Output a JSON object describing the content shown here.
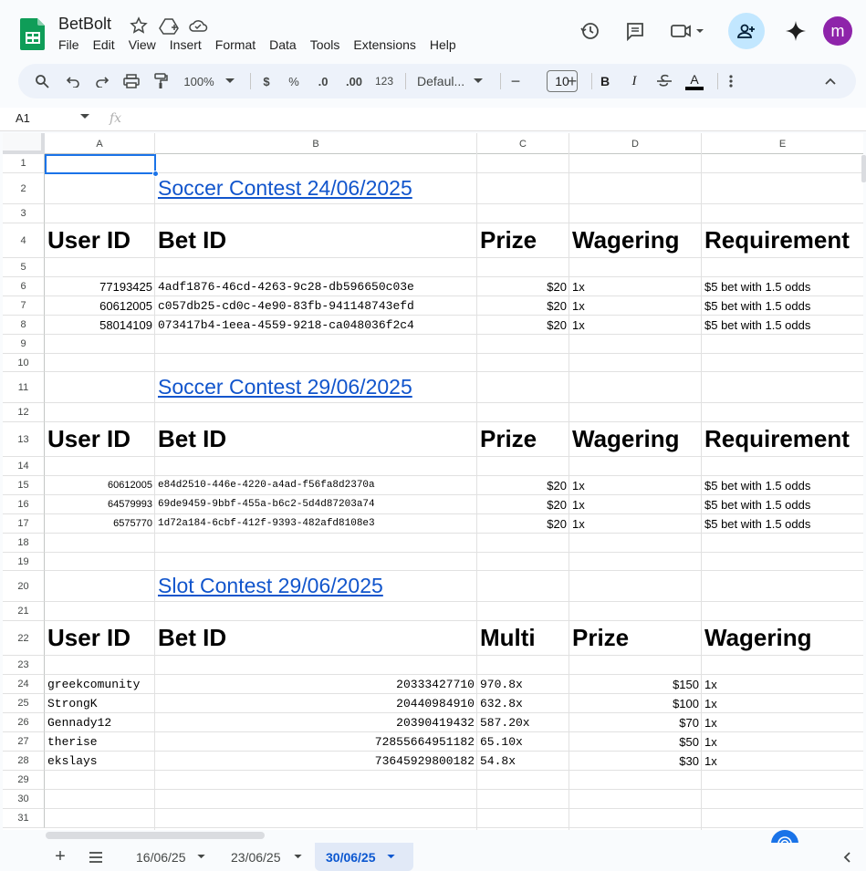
{
  "app": {
    "doc_title": "BetBolt",
    "avatar_letter": "m",
    "brand_color": "#0f9d58"
  },
  "menu": [
    "File",
    "Edit",
    "View",
    "Insert",
    "Format",
    "Data",
    "Tools",
    "Extensions",
    "Help"
  ],
  "toolbar": {
    "zoom": "100%",
    "currency": "$",
    "percent": "%",
    "dec_decrease": ".0",
    "dec_increase": ".00",
    "format_123": "123",
    "font": "Defaul...",
    "font_size": "10",
    "bold": "B",
    "italic": "I",
    "text_color": "A"
  },
  "formula": {
    "name_box": "A1",
    "fx": "fx"
  },
  "columns": [
    "A",
    "B",
    "C",
    "D",
    "E"
  ],
  "rows": [
    "1",
    "2",
    "3",
    "4",
    "5",
    "6",
    "7",
    "8",
    "9",
    "10",
    "11",
    "12",
    "13",
    "14",
    "15",
    "16",
    "17",
    "18",
    "19",
    "20",
    "21",
    "22",
    "23",
    "24",
    "25",
    "26",
    "27",
    "28",
    "29",
    "30",
    "31"
  ],
  "sections": {
    "s1": {
      "title": "Soccer Contest 24/06/2025",
      "headers": [
        "User ID",
        "Bet ID",
        "Prize",
        "Wagering",
        "Requirement"
      ],
      "rows": [
        [
          "77193425",
          "4adf1876-46cd-4263-9c28-db596650c03e",
          "$20",
          "1x",
          "$5 bet with 1.5 odds"
        ],
        [
          "60612005",
          "c057db25-cd0c-4e90-83fb-941148743efd",
          "$20",
          "1x",
          "$5 bet with 1.5 odds"
        ],
        [
          "58014109",
          "073417b4-1eea-4559-9218-ca048036f2c4",
          "$20",
          "1x",
          "$5 bet with 1.5 odds"
        ]
      ]
    },
    "s2": {
      "title": "Soccer Contest 29/06/2025",
      "headers": [
        "User ID",
        "Bet ID",
        "Prize",
        "Wagering",
        "Requirement"
      ],
      "rows": [
        [
          "60612005",
          "e84d2510-446e-4220-a4ad-f56fa8d2370a",
          "$20",
          "1x",
          "$5 bet with 1.5 odds"
        ],
        [
          "64579993",
          "69de9459-9bbf-455a-b6c2-5d4d87203a74",
          "$20",
          "1x",
          "$5 bet with 1.5 odds"
        ],
        [
          "6575770",
          "1d72a184-6cbf-412f-9393-482afd8108e3",
          "$20",
          "1x",
          "$5 bet with 1.5 odds"
        ]
      ]
    },
    "s3": {
      "title": "Slot Contest 29/06/2025",
      "headers": [
        "User ID",
        "Bet ID",
        "Multi",
        "Prize",
        "Wagering"
      ],
      "rows": [
        [
          "greekcomunity",
          "20333427710",
          "970.8x",
          "$150",
          "1x"
        ],
        [
          "StrongK",
          "20440984910",
          "632.8x",
          "$100",
          "1x"
        ],
        [
          "Gennady12",
          "20390419432",
          "587.20x",
          "$70",
          "1x"
        ],
        [
          "therise",
          "72855664951182",
          "65.10x",
          "$50",
          "1x"
        ],
        [
          "ekslays",
          "73645929800182",
          "54.8x",
          "$30",
          "1x"
        ]
      ]
    }
  },
  "sheets": {
    "tabs": [
      "16/06/25",
      "23/06/25",
      "30/06/25"
    ],
    "active": "30/06/25"
  }
}
